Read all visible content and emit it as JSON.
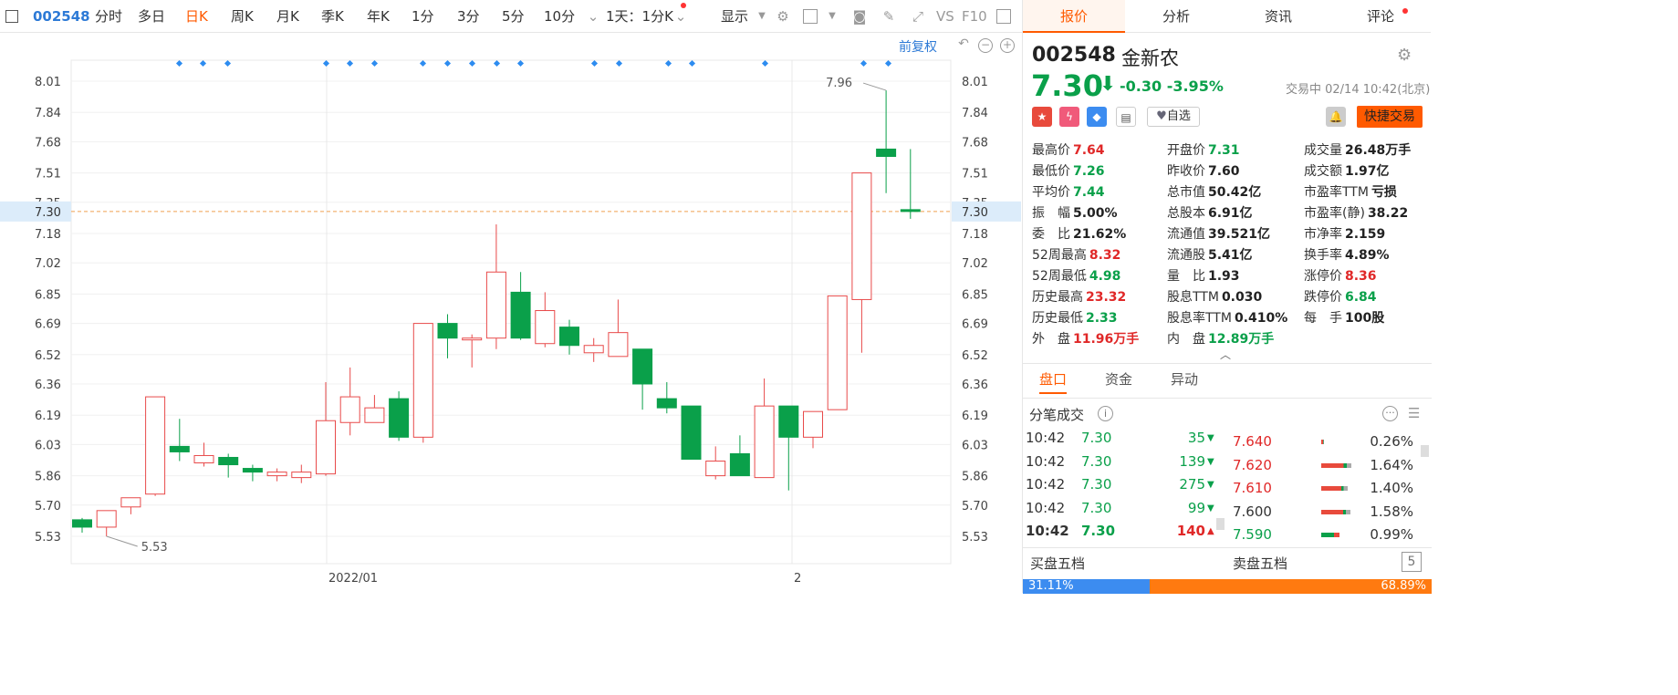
{
  "toolbar": {
    "code": "002548",
    "periods": [
      "分时",
      "多日",
      "日K",
      "周K",
      "月K",
      "季K",
      "年K",
      "1分",
      "3分",
      "5分",
      "10分"
    ],
    "active_period": "日K",
    "range_select": "1天：1分K",
    "display": "显示",
    "vs": "VS",
    "f10": "F10"
  },
  "chart": {
    "adjust_label": "前复权",
    "y_ticks": [
      "8.01",
      "7.84",
      "7.68",
      "7.51",
      "7.35",
      "7.18",
      "7.02",
      "6.85",
      "6.69",
      "6.52",
      "6.36",
      "6.19",
      "6.03",
      "5.86",
      "5.70",
      "5.53"
    ],
    "current_price_label": "7.30",
    "high_marker": "7.96",
    "low_marker": "5.53",
    "x_labels": [
      "2022/01",
      "2"
    ]
  },
  "chart_data": {
    "type": "candlestick",
    "current_price": 7.3,
    "ylim": [
      5.45,
      8.1
    ],
    "candles": [
      {
        "o": 5.62,
        "h": 5.63,
        "l": 5.55,
        "c": 5.58
      },
      {
        "o": 5.58,
        "h": 5.67,
        "l": 5.53,
        "c": 5.67
      },
      {
        "o": 5.69,
        "h": 5.74,
        "l": 5.65,
        "c": 5.74
      },
      {
        "o": 5.76,
        "h": 6.29,
        "l": 5.75,
        "c": 6.29
      },
      {
        "o": 6.02,
        "h": 6.17,
        "l": 5.94,
        "c": 5.99
      },
      {
        "o": 5.93,
        "h": 6.04,
        "l": 5.91,
        "c": 5.97
      },
      {
        "o": 5.96,
        "h": 5.98,
        "l": 5.85,
        "c": 5.92
      },
      {
        "o": 5.9,
        "h": 5.92,
        "l": 5.83,
        "c": 5.88
      },
      {
        "o": 5.86,
        "h": 5.9,
        "l": 5.83,
        "c": 5.88
      },
      {
        "o": 5.85,
        "h": 5.92,
        "l": 5.82,
        "c": 5.88
      },
      {
        "o": 5.87,
        "h": 6.37,
        "l": 5.86,
        "c": 6.16
      },
      {
        "o": 6.15,
        "h": 6.45,
        "l": 6.08,
        "c": 6.29
      },
      {
        "o": 6.15,
        "h": 6.3,
        "l": 6.15,
        "c": 6.23
      },
      {
        "o": 6.28,
        "h": 6.32,
        "l": 6.05,
        "c": 6.07
      },
      {
        "o": 6.07,
        "h": 6.69,
        "l": 6.04,
        "c": 6.69
      },
      {
        "o": 6.69,
        "h": 6.74,
        "l": 6.5,
        "c": 6.61
      },
      {
        "o": 6.61,
        "h": 6.63,
        "l": 6.45,
        "c": 6.61
      },
      {
        "o": 6.61,
        "h": 7.23,
        "l": 6.55,
        "c": 6.97
      },
      {
        "o": 6.86,
        "h": 6.97,
        "l": 6.6,
        "c": 6.61
      },
      {
        "o": 6.58,
        "h": 6.86,
        "l": 6.56,
        "c": 6.76
      },
      {
        "o": 6.67,
        "h": 6.71,
        "l": 6.52,
        "c": 6.57
      },
      {
        "o": 6.53,
        "h": 6.61,
        "l": 6.48,
        "c": 6.57
      },
      {
        "o": 6.51,
        "h": 6.82,
        "l": 6.51,
        "c": 6.64
      },
      {
        "o": 6.55,
        "h": 6.55,
        "l": 6.22,
        "c": 6.36
      },
      {
        "o": 6.28,
        "h": 6.37,
        "l": 6.2,
        "c": 6.23
      },
      {
        "o": 6.24,
        "h": 6.24,
        "l": 5.95,
        "c": 5.95
      },
      {
        "o": 5.86,
        "h": 6.02,
        "l": 5.84,
        "c": 5.94
      },
      {
        "o": 5.98,
        "h": 6.08,
        "l": 5.86,
        "c": 5.86
      },
      {
        "o": 5.85,
        "h": 6.39,
        "l": 5.85,
        "c": 6.24
      },
      {
        "o": 6.24,
        "h": 6.24,
        "l": 5.78,
        "c": 6.07
      },
      {
        "o": 6.07,
        "h": 6.21,
        "l": 6.01,
        "c": 6.21
      },
      {
        "o": 6.22,
        "h": 6.84,
        "l": 6.22,
        "c": 6.84
      },
      {
        "o": 6.82,
        "h": 7.51,
        "l": 6.53,
        "c": 7.51
      },
      {
        "o": 7.64,
        "h": 7.96,
        "l": 7.4,
        "c": 7.6
      },
      {
        "o": 7.31,
        "h": 7.64,
        "l": 7.26,
        "c": 7.3
      }
    ]
  },
  "quote": {
    "code": "002548",
    "name": "金新农",
    "price": "7.30",
    "arrow": "⬇",
    "change": "-0.30",
    "change_pct": "-3.95%",
    "status_time": "交易中 02/14 10:42(北京)",
    "zixuan": "自选",
    "fast_trade": "快捷交易"
  },
  "tabs": [
    "报价",
    "分析",
    "资讯",
    "评论"
  ],
  "stats": [
    [
      {
        "label": "最高价",
        "value": "7.64",
        "color": "r"
      },
      {
        "label": "开盘价",
        "value": "7.31",
        "color": "g"
      },
      {
        "label": "成交量",
        "value": "26.48万手",
        "color": ""
      }
    ],
    [
      {
        "label": "最低价",
        "value": "7.26",
        "color": "g"
      },
      {
        "label": "昨收价",
        "value": "7.60",
        "color": ""
      },
      {
        "label": "成交额",
        "value": "1.97亿",
        "color": ""
      }
    ],
    [
      {
        "label": "平均价",
        "value": "7.44",
        "color": "g"
      },
      {
        "label": "总市值",
        "value": "50.42亿",
        "color": ""
      },
      {
        "label": "市盈率TTM",
        "value": "亏损",
        "color": ""
      }
    ],
    [
      {
        "label": "振　幅",
        "value": "5.00%",
        "color": ""
      },
      {
        "label": "总股本",
        "value": "6.91亿",
        "color": ""
      },
      {
        "label": "市盈率(静)",
        "value": "38.22",
        "color": ""
      }
    ],
    [
      {
        "label": "委　比",
        "value": "21.62%",
        "color": ""
      },
      {
        "label": "流通值",
        "value": "39.521亿",
        "color": ""
      },
      {
        "label": "市净率",
        "value": "2.159",
        "color": ""
      }
    ],
    [
      {
        "label": "52周最高",
        "value": "8.32",
        "color": "r"
      },
      {
        "label": "流通股",
        "value": "5.41亿",
        "color": ""
      },
      {
        "label": "换手率",
        "value": "4.89%",
        "color": ""
      }
    ],
    [
      {
        "label": "52周最低",
        "value": "4.98",
        "color": "g"
      },
      {
        "label": "量　比",
        "value": "1.93",
        "color": ""
      },
      {
        "label": "涨停价",
        "value": "8.36",
        "color": "r"
      }
    ],
    [
      {
        "label": "历史最高",
        "value": "23.32",
        "color": "r"
      },
      {
        "label": "股息TTM",
        "value": "0.030",
        "color": ""
      },
      {
        "label": "跌停价",
        "value": "6.84",
        "color": "g"
      }
    ],
    [
      {
        "label": "历史最低",
        "value": "2.33",
        "color": "g"
      },
      {
        "label": "股息率TTM",
        "value": "0.410%",
        "color": ""
      },
      {
        "label": "每　手",
        "value": "100股",
        "color": ""
      }
    ],
    [
      {
        "label": "外　盘",
        "value": "11.96万手",
        "color": "r"
      },
      {
        "label": "内　盘",
        "value": "12.89万手",
        "color": "g"
      },
      {
        "label": "",
        "value": "",
        "color": ""
      }
    ]
  ],
  "subtabs": [
    "盘口",
    "资金",
    "异动"
  ],
  "ticks_title": "分笔成交",
  "ticks": [
    {
      "time": "10:42",
      "price": "7.30",
      "vol": "35",
      "dir": "down"
    },
    {
      "time": "10:42",
      "price": "7.30",
      "vol": "139",
      "dir": "down"
    },
    {
      "time": "10:42",
      "price": "7.30",
      "vol": "275",
      "dir": "down"
    },
    {
      "time": "10:42",
      "price": "7.30",
      "vol": "99",
      "dir": "down"
    },
    {
      "time": "10:42",
      "price": "7.30",
      "vol": "140",
      "dir": "up"
    }
  ],
  "price_dist": [
    {
      "price": "7.640",
      "pct": "0.26%",
      "share": 0.03
    },
    {
      "price": "7.620",
      "pct": "1.64%",
      "share": 0.55
    },
    {
      "price": "7.610",
      "pct": "1.40%",
      "share": 0.48
    },
    {
      "price": "7.600",
      "pct": "1.58%",
      "share": 0.53
    },
    {
      "price": "7.590",
      "pct": "0.99%",
      "share": 0.34
    }
  ],
  "bottom": {
    "buy5": "买盘五档",
    "sell5": "卖盘五档",
    "buy_pct": "31.11%",
    "sell_pct": "68.89%",
    "buy_share": 0.3111
  }
}
